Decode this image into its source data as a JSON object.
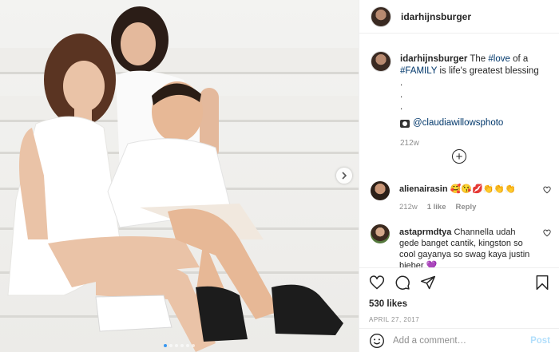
{
  "post": {
    "username": "idarhijnsburger",
    "caption": {
      "username": "idarhijnsburger",
      "text_1": "The ",
      "tag_love": "#love",
      "text_2": " of a",
      "tag_family": "#FAMILY",
      "text_3": " is life's greatest blessing",
      "dots": [
        ".",
        ".",
        "."
      ],
      "credit_handle": "@claudiawillowsphoto",
      "time": "212w"
    },
    "comments": [
      {
        "username": "alienairasin",
        "text": "🥰😘💋👏👏👏",
        "time": "212w",
        "likes": "1 like",
        "reply": "Reply"
      },
      {
        "username": "astaprmdtya",
        "text": "Channella udah gede banget cantik, kingston so cool gayanya so swag kaya justin bieber 💜"
      }
    ],
    "likes": "530 likes",
    "date": "APRIL 27, 2017",
    "add_comment_placeholder": "Add a comment…",
    "post_label": "Post"
  },
  "carousel": {
    "slides": 6,
    "active_index": 0
  },
  "colors": {
    "link": "#00376b",
    "post_button": "#b2dffc",
    "meta": "#8e8e8e",
    "active_dot": "#3897f0"
  },
  "icons": [
    "more-options-icon",
    "heart-icon",
    "comment-icon",
    "share-icon",
    "bookmark-icon",
    "emoji-icon",
    "chevron-right-icon",
    "camera-icon"
  ]
}
